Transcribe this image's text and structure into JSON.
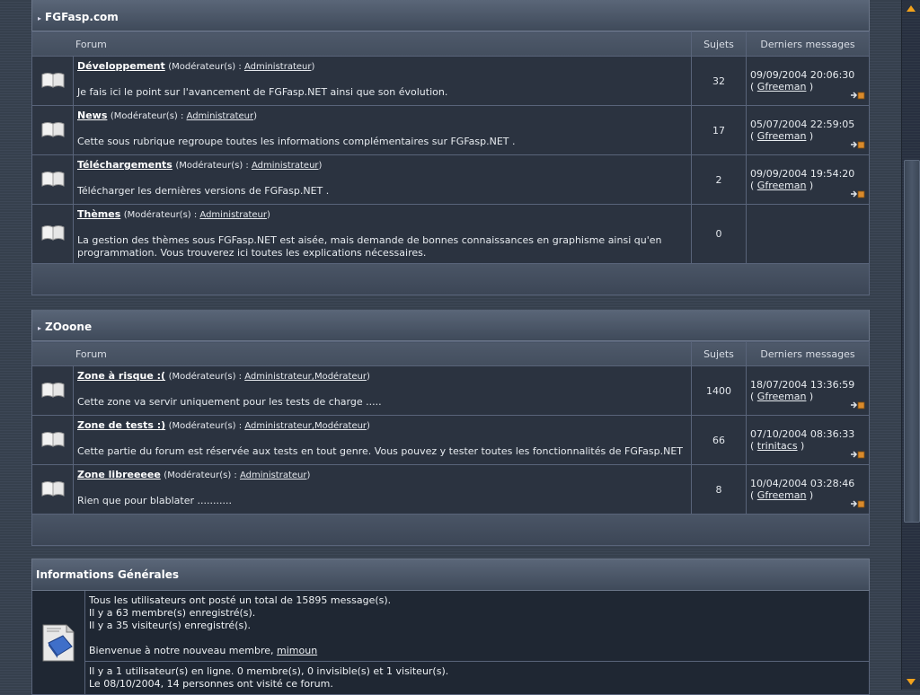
{
  "sections": [
    {
      "title": "FGFasp.com",
      "headers": {
        "forum": "Forum",
        "topics": "Sujets",
        "last": "Derniers messages"
      },
      "forums": [
        {
          "name": "Développement",
          "mods_prefix": "(Modérateur(s) : ",
          "mods": "Administrateur",
          "mods_suffix": ")",
          "desc": "Je fais ici le point sur l'avancement de FGFasp.NET ainsi que son évolution.",
          "topics": "32",
          "last_date": "09/09/2004 20:06:30",
          "last_user": "Gfreeman"
        },
        {
          "name": "News",
          "mods_prefix": "(Modérateur(s) : ",
          "mods": "Administrateur",
          "mods_suffix": ")",
          "desc": "Cette sous rubrique regroupe toutes les informations complémentaires sur FGFasp.NET .",
          "topics": "17",
          "last_date": "05/07/2004 22:59:05",
          "last_user": "Gfreeman"
        },
        {
          "name": "Téléchargements",
          "mods_prefix": "(Modérateur(s) : ",
          "mods": "Administrateur",
          "mods_suffix": ")",
          "desc": "Télécharger les dernières versions de FGFasp.NET .",
          "topics": "2",
          "last_date": "09/09/2004 19:54:20",
          "last_user": "Gfreeman"
        },
        {
          "name": "Thèmes",
          "mods_prefix": "(Modérateur(s) : ",
          "mods": "Administrateur",
          "mods_suffix": ")",
          "desc": "La gestion des thèmes sous FGFasp.NET est aisée, mais demande de bonnes connaissances en graphisme ainsi qu'en programmation. Vous trouverez ici toutes les explications nécessaires.",
          "topics": "0",
          "last_date": "",
          "last_user": ""
        }
      ]
    },
    {
      "title": "ZOoone",
      "headers": {
        "forum": "Forum",
        "topics": "Sujets",
        "last": "Derniers messages"
      },
      "forums": [
        {
          "name": "Zone à risque :(",
          "mods_prefix": "(Modérateur(s) : ",
          "mods": "Administrateur,Modérateur",
          "mods_suffix": ")",
          "desc": "Cette zone va servir uniquement pour les tests de charge .....",
          "topics": "1400",
          "last_date": "18/07/2004 13:36:59",
          "last_user": "Gfreeman"
        },
        {
          "name": "Zone de tests :)",
          "mods_prefix": "(Modérateur(s) : ",
          "mods": "Administrateur,Modérateur",
          "mods_suffix": ")",
          "desc": "Cette partie du forum est réservée aux tests en tout genre. Vous pouvez y tester toutes les fonctionnalités de FGFasp.NET",
          "topics": "66",
          "last_date": "07/10/2004 08:36:33",
          "last_user": "trinitacs"
        },
        {
          "name": "Zone libreeeee",
          "mods_prefix": "(Modérateur(s) : ",
          "mods": "Administrateur",
          "mods_suffix": ")",
          "desc": "Rien que pour blablater ...........",
          "topics": "8",
          "last_date": "10/04/2004 03:28:46",
          "last_user": "Gfreeman"
        }
      ]
    }
  ],
  "info": {
    "title": "Informations Générales",
    "line1": "Tous les utilisateurs ont posté un total de 15895 message(s).",
    "line2": "Il y a 63 membre(s) enregistré(s).",
    "line3": "Il y a 35 visiteur(s) enregistré(s).",
    "welcome_prefix": "Bienvenue à notre nouveau membre, ",
    "welcome_user": "mimoun",
    "online": "Il y a 1 utilisateur(s) en ligne. 0 membre(s), 0 invisible(s) et 1 visiteur(s).",
    "visits": "Le 08/10/2004, 14 personnes ont visité ce forum."
  }
}
